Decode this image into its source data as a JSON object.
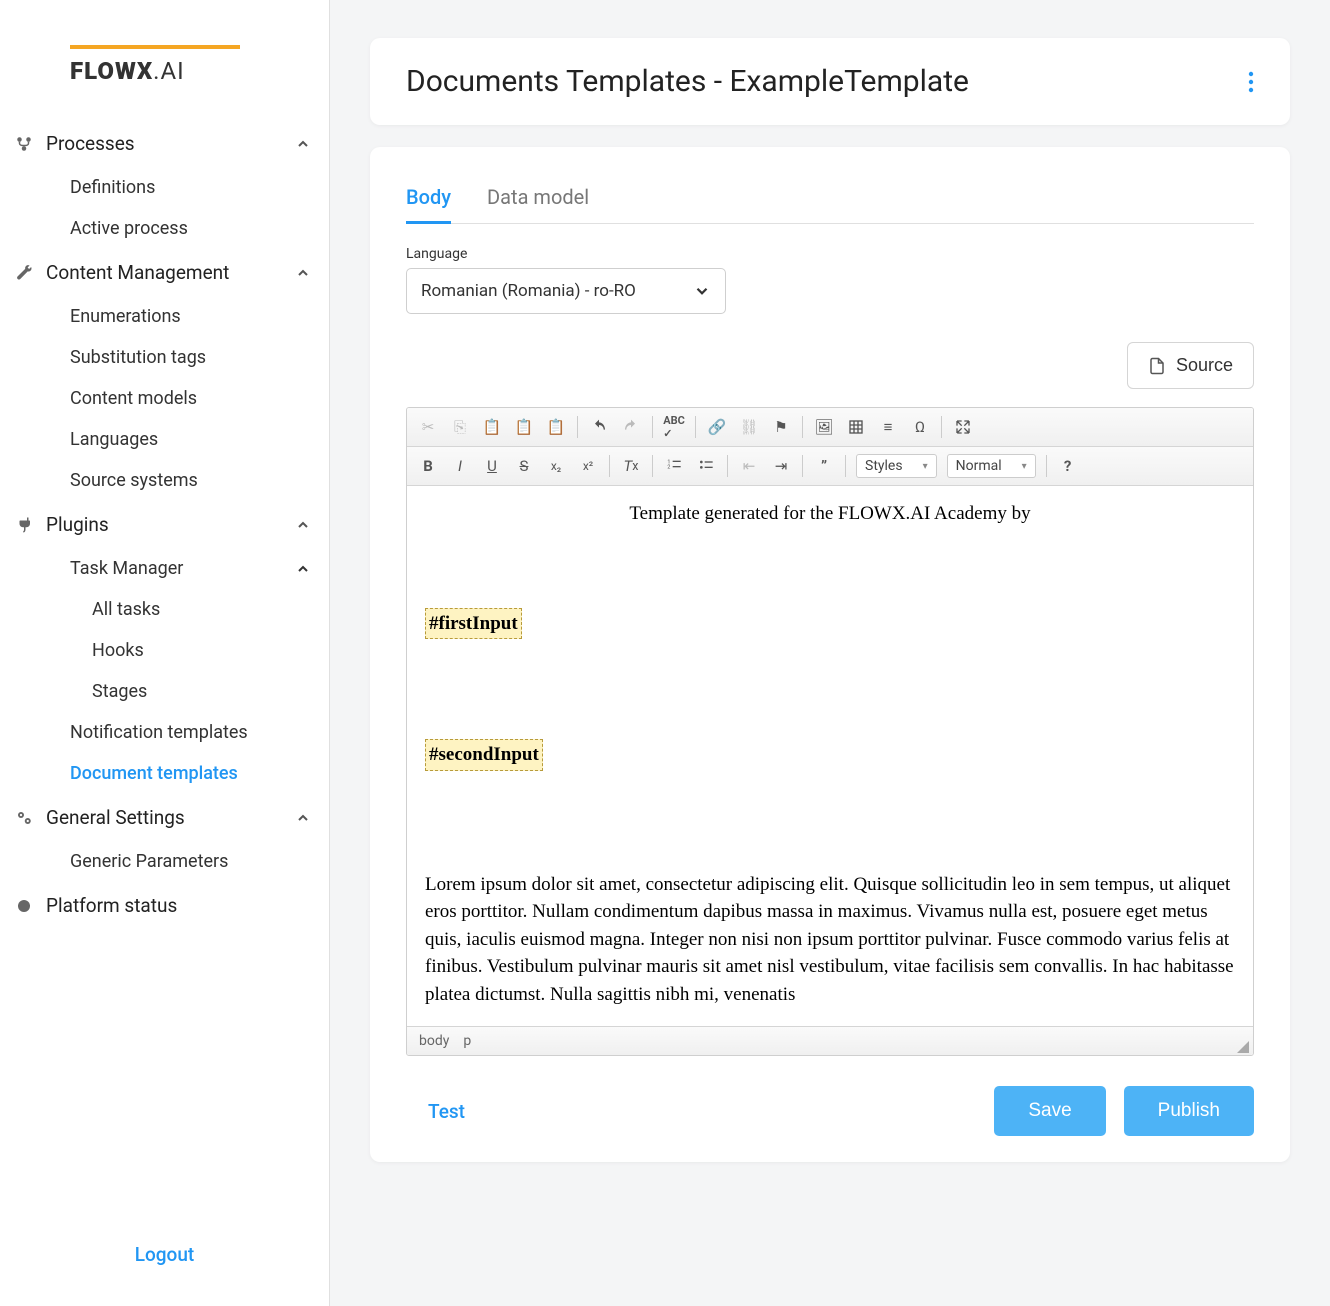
{
  "brand": {
    "name": "FLOWX",
    "suffix": ".AI"
  },
  "sidebar": {
    "processes": {
      "label": "Processes",
      "items": [
        "Definitions",
        "Active process"
      ]
    },
    "content": {
      "label": "Content Management",
      "items": [
        "Enumerations",
        "Substitution tags",
        "Content models",
        "Languages",
        "Source systems"
      ]
    },
    "plugins": {
      "label": "Plugins",
      "task_manager": {
        "label": "Task Manager",
        "items": [
          "All tasks",
          "Hooks",
          "Stages"
        ]
      },
      "notification": "Notification templates",
      "document": "Document templates"
    },
    "general": {
      "label": "General Settings",
      "items": [
        "Generic Parameters"
      ]
    },
    "platform_status": "Platform status",
    "logout": "Logout"
  },
  "header": {
    "title": "Documents Templates - ExampleTemplate"
  },
  "tabs": {
    "body": "Body",
    "data_model": "Data model"
  },
  "language": {
    "label": "Language",
    "value": "Romanian (Romania) - ro-RO"
  },
  "source_button": "Source",
  "toolbar": {
    "styles": "Styles",
    "format": "Normal"
  },
  "editor": {
    "heading": "Template generated for the FLOWX.AI Academy by",
    "placeholder1": "#firstInput",
    "placeholder2": "#secondInput",
    "lorem": "Lorem ipsum dolor sit amet, consectetur adipiscing elit. Quisque sollicitudin leo in sem tempus, ut aliquet eros porttitor. Nullam condimentum dapibus massa in maximus. Vivamus nulla est, posuere eget metus quis, iaculis euismod magna. Integer non nisi non ipsum porttitor pulvinar. Fusce commodo varius felis at finibus. Vestibulum pulvinar mauris sit amet nisl vestibulum, vitae facilisis sem convallis. In hac habitasse platea dictumst. Nulla sagittis nibh mi, venenatis",
    "status_body": "body",
    "status_p": "p"
  },
  "actions": {
    "test": "Test",
    "save": "Save",
    "publish": "Publish"
  }
}
